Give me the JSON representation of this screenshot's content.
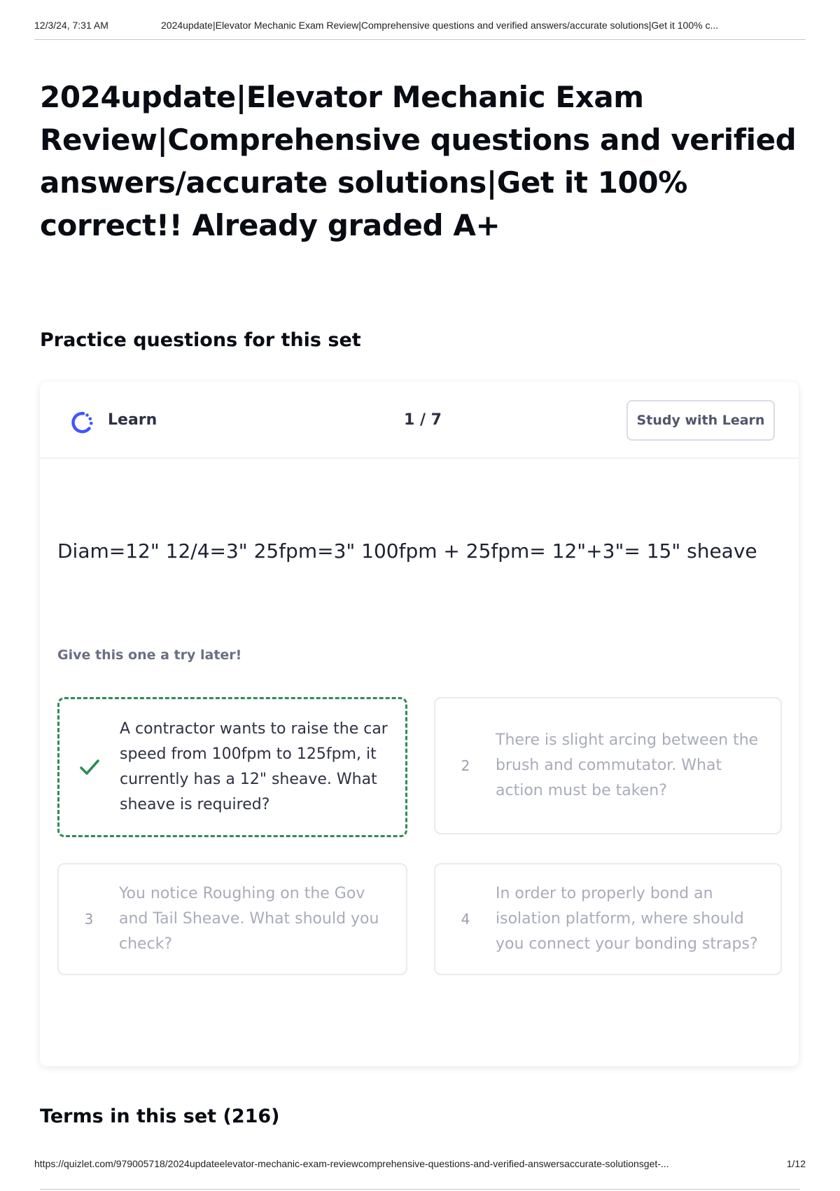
{
  "print_header": {
    "datetime": "12/3/24, 7:31 AM",
    "title": "2024update|Elevator Mechanic Exam Review|Comprehensive questions and verified answers/accurate solutions|Get it 100% c..."
  },
  "page": {
    "title": "2024update|Elevator Mechanic Exam Review|Comprehensive questions and verified answers/accurate solutions|Get it 100% correct!! Already graded A+"
  },
  "practice": {
    "heading": "Practice questions for this set",
    "card": {
      "mode_label": "Learn",
      "mode_icon": "learn-icon",
      "progress": "1 / 7",
      "study_button_label": "Study with Learn",
      "prompt": "Diam=12\" 12/4=3\" 25fpm=3\" 100fpm + 25fpm= 12\"+3\"= 15\" sheave",
      "hint": "Give this one a try later!",
      "options": [
        {
          "marker": "",
          "marker_icon": "check-icon",
          "text": "A contractor wants to raise the car speed from 100fpm to 125fpm, it currently has a 12\" sheave. What sheave is required?",
          "correct": true
        },
        {
          "marker": "2",
          "text": "There is slight arcing between the brush and commutator. What action must be taken?",
          "correct": false
        },
        {
          "marker": "3",
          "text": "You notice Roughing on the Gov and Tail Sheave. What should you check?",
          "correct": false
        },
        {
          "marker": "4",
          "text": "In order to properly bond an isolation platform, where should you connect your bonding straps?",
          "correct": false
        }
      ]
    }
  },
  "terms": {
    "heading": "Terms in this set (216)"
  },
  "print_footer": {
    "url": "https://quizlet.com/979005718/2024updateelevator-mechanic-exam-reviewcomprehensive-questions-and-verified-answersaccurate-solutionsget-...",
    "page_number": "1/12"
  },
  "colors": {
    "correct_accent": "#2e8b57",
    "learn_icon": "#4255ff",
    "border": "#e8eaf0"
  }
}
